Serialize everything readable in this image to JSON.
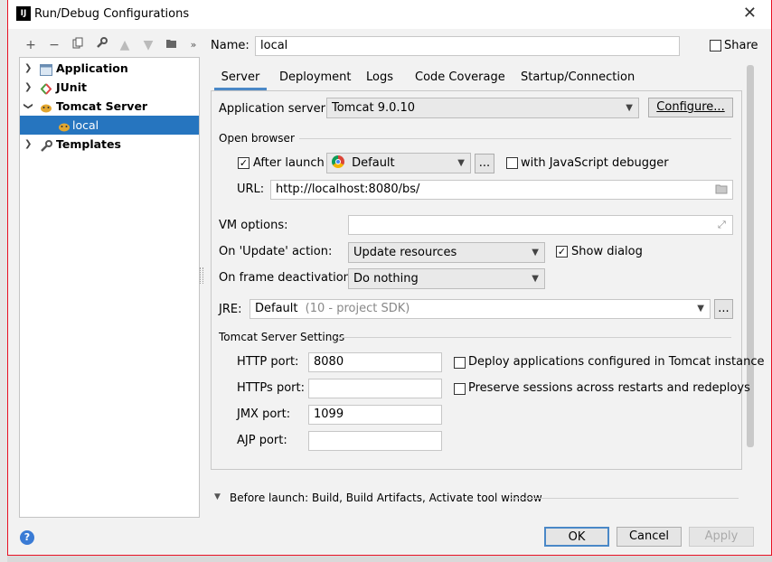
{
  "window": {
    "title": "Run/Debug Configurations",
    "app_icon": "IJ"
  },
  "toolbar": {
    "icons": [
      "add-icon",
      "remove-icon",
      "copy-icon",
      "wrench-icon",
      "move-up-icon",
      "move-down-icon",
      "folder-add-icon",
      "more-icon"
    ]
  },
  "tree": {
    "items": [
      {
        "label": "Application",
        "expanded": false
      },
      {
        "label": "JUnit",
        "expanded": false
      },
      {
        "label": "Tomcat Server",
        "expanded": true
      },
      {
        "label": "local",
        "selected": true
      },
      {
        "label": "Templates",
        "expanded": false
      }
    ]
  },
  "name": {
    "label": "Name:",
    "value": "local"
  },
  "share": {
    "label": "Share",
    "checked": false
  },
  "tabs": [
    "Server",
    "Deployment",
    "Logs",
    "Code Coverage",
    "Startup/Connection"
  ],
  "server": {
    "app_server_label": "Application server:",
    "app_server_value": "Tomcat 9.0.10",
    "configure_label": "Configure...",
    "open_browser_label": "Open browser",
    "after_launch_label": "After launch",
    "after_launch_checked": true,
    "browser_value": "Default",
    "ellipsis": "...",
    "js_debugger_label": "with JavaScript debugger",
    "js_debugger_checked": false,
    "url_label": "URL:",
    "url_value": "http://localhost:8080/bs/",
    "vm_options_label": "VM options:",
    "vm_options_value": "",
    "on_update_label": "On 'Update' action:",
    "on_update_value": "Update resources",
    "show_dialog_label": "Show dialog",
    "show_dialog_checked": true,
    "on_frame_label": "On frame deactivation:",
    "on_frame_value": "Do nothing",
    "jre_label": "JRE:",
    "jre_value": "Default",
    "jre_hint": "(10 - project SDK)",
    "tomcat_settings_label": "Tomcat Server Settings",
    "http_port_label": "HTTP port:",
    "http_port_value": "8080",
    "https_port_label": "HTTPs port:",
    "https_port_value": "",
    "jmx_port_label": "JMX port:",
    "jmx_port_value": "1099",
    "ajp_port_label": "AJP port:",
    "ajp_port_value": "",
    "deploy_label": "Deploy applications configured in Tomcat instance",
    "deploy_checked": false,
    "preserve_label": "Preserve sessions across restarts and redeploys",
    "preserve_checked": false
  },
  "before_launch": {
    "label": "Before launch: Build, Build Artifacts, Activate tool window"
  },
  "footer": {
    "ok_label": "OK",
    "cancel_label": "Cancel",
    "apply_label": "Apply",
    "help_glyph": "?"
  },
  "colors": {
    "selection": "#2675bf",
    "accent": "#4a88c7",
    "window_border": "#e81123"
  }
}
